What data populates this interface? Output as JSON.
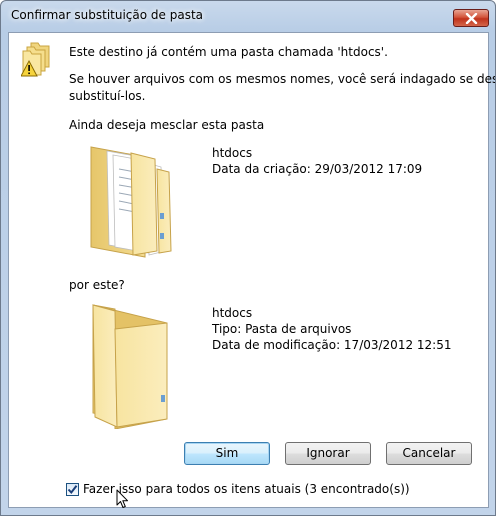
{
  "window": {
    "title": "Confirmar substituição de pasta"
  },
  "message": {
    "line1": "Este destino já contém uma pasta chamada 'htdocs'.",
    "line2a": "Se houver arquivos com os mesmos nomes, você será indagado se deseja",
    "line2b": "substituí-los.",
    "line3": "Ainda deseja mesclar esta pasta"
  },
  "destination_folder": {
    "name": "htdocs",
    "created": "Data da criação: 29/03/2012 17:09"
  },
  "by_this_label": "por este?",
  "source_folder": {
    "name": "htdocs",
    "type": "Tipo: Pasta de arquivos",
    "modified": "Data de modificação: 17/03/2012 12:51"
  },
  "buttons": {
    "yes": "Sim",
    "skip": "Ignorar",
    "cancel": "Cancelar"
  },
  "apply_all": {
    "label": "Fazer isso para todos os itens atuais (3 encontrado(s))",
    "checked": true
  },
  "icons": {
    "title_close": "close-icon",
    "warning": "folder-warning-icon",
    "dest_folder": "folder-with-documents-icon",
    "src_folder": "empty-folder-icon",
    "pointer": "mouse-pointer-icon"
  }
}
